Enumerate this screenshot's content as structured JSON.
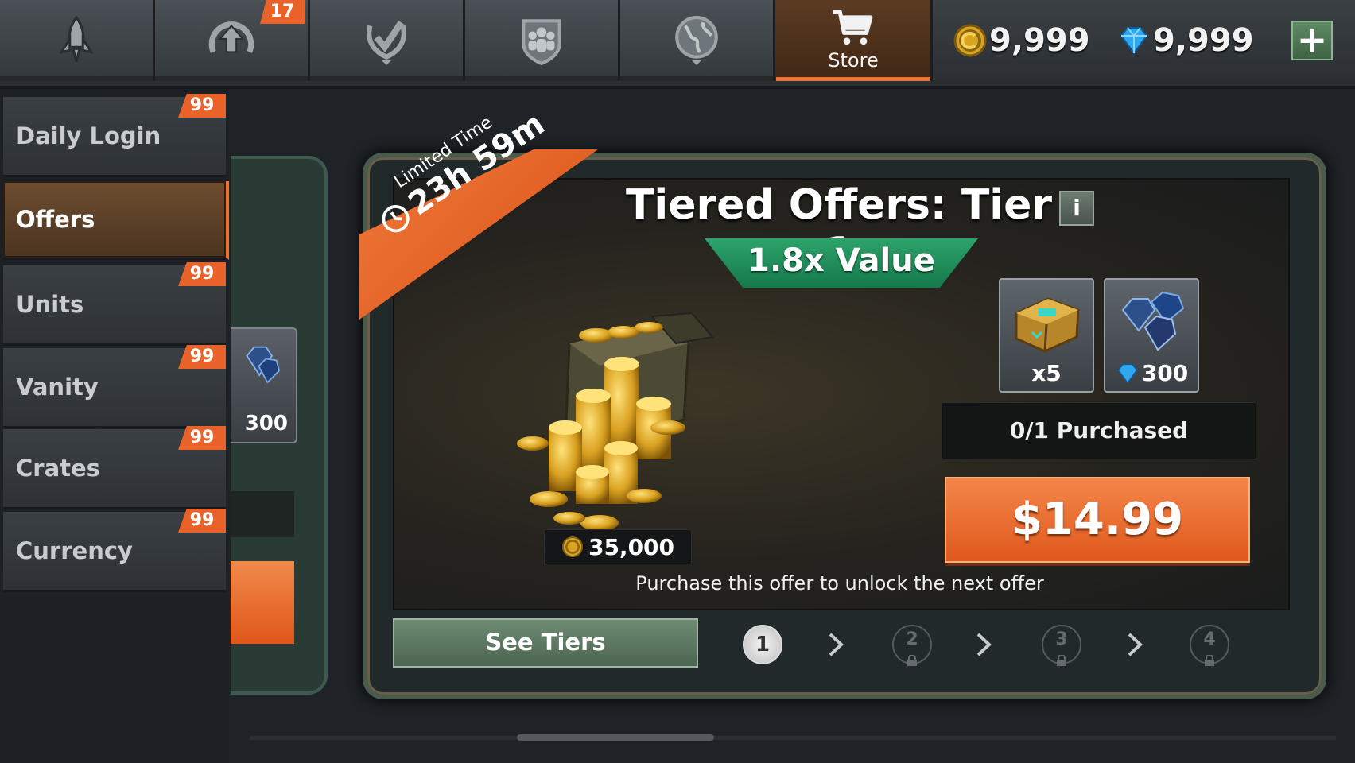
{
  "topbar": {
    "tabs": [
      {
        "icon": "rocket-icon"
      },
      {
        "icon": "upgrade-arrow-icon",
        "badge": "17"
      },
      {
        "icon": "achievement-check-icon"
      },
      {
        "icon": "alliance-shield-icon"
      },
      {
        "icon": "globe-icon"
      },
      {
        "icon": "cart-icon",
        "label": "Store",
        "active": true
      }
    ],
    "coins": "9,999",
    "gems": "9,999",
    "add_label": "+"
  },
  "sidebar": {
    "items": [
      {
        "label": "Daily Login",
        "badge": "99"
      },
      {
        "label": "Offers",
        "active": true
      },
      {
        "label": "Units",
        "badge": "99"
      },
      {
        "label": "Vanity",
        "badge": "99"
      },
      {
        "label": "Crates",
        "badge": "99"
      },
      {
        "label": "Currency",
        "badge": "99"
      }
    ]
  },
  "background_card": {
    "gem_amount": "300"
  },
  "offer": {
    "ribbon_label": "Limited Time",
    "ribbon_timer": "23h 59m",
    "title": "Tiered Offers: Tier 1",
    "info_label": "i",
    "value_banner": "1.8x Value",
    "coin_amount": "35,000",
    "rewards": [
      {
        "icon": "crate-icon",
        "qty": "x5"
      },
      {
        "icon": "gem-icon",
        "qty": "300"
      }
    ],
    "purchased_status": "0/1 Purchased",
    "price": "$14.99",
    "unlock_note": "Purchase this offer to unlock the next offer",
    "see_tiers_label": "See Tiers",
    "tiers": [
      {
        "number": "1",
        "state": "current"
      },
      {
        "number": "2",
        "state": "locked"
      },
      {
        "number": "3",
        "state": "locked"
      },
      {
        "number": "4",
        "state": "locked"
      }
    ]
  },
  "colors": {
    "accent_orange": "#e8622a",
    "value_green": "#1f8f5a",
    "panel_dark": "#22292a"
  }
}
